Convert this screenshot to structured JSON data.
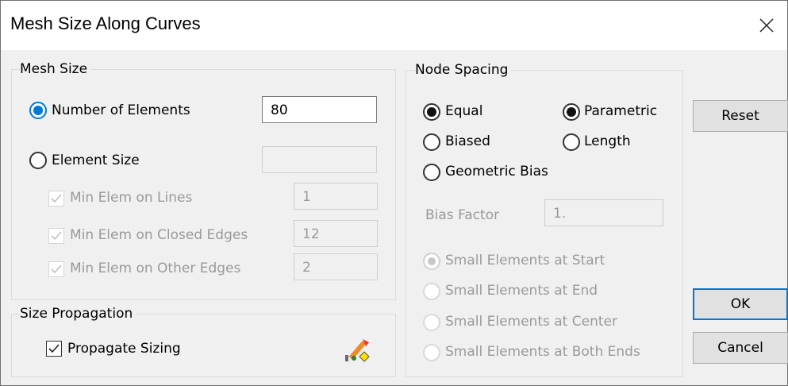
{
  "window": {
    "title": "Mesh Size Along Curves"
  },
  "mesh_size": {
    "legend": "Mesh Size",
    "number_of_elements_label": "Number of Elements",
    "number_of_elements_value": "80",
    "element_size_label": "Element Size",
    "element_size_value": "",
    "min_elem_lines_label": "Min Elem on Lines",
    "min_elem_lines_value": "1",
    "min_elem_closed_label": "Min Elem on Closed Edges",
    "min_elem_closed_value": "12",
    "min_elem_other_label": "Min Elem on Other Edges",
    "min_elem_other_value": "2"
  },
  "size_propagation": {
    "legend": "Size Propagation",
    "propagate_label": "Propagate Sizing"
  },
  "node_spacing": {
    "legend": "Node Spacing",
    "equal_label": "Equal",
    "biased_label": "Biased",
    "geometric_bias_label": "Geometric Bias",
    "parametric_label": "Parametric",
    "length_label": "Length",
    "bias_factor_label": "Bias Factor",
    "bias_factor_value": "1.",
    "small_start_label": "Small Elements at Start",
    "small_end_label": "Small Elements at End",
    "small_center_label": "Small Elements at Center",
    "small_both_label": "Small Elements at Both Ends"
  },
  "buttons": {
    "reset": "Reset",
    "ok": "OK",
    "cancel": "Cancel"
  },
  "colors": {
    "accent": "#0078d7",
    "disabled_text": "#9a9a9a",
    "dialog_bg": "#f0f0f0"
  }
}
